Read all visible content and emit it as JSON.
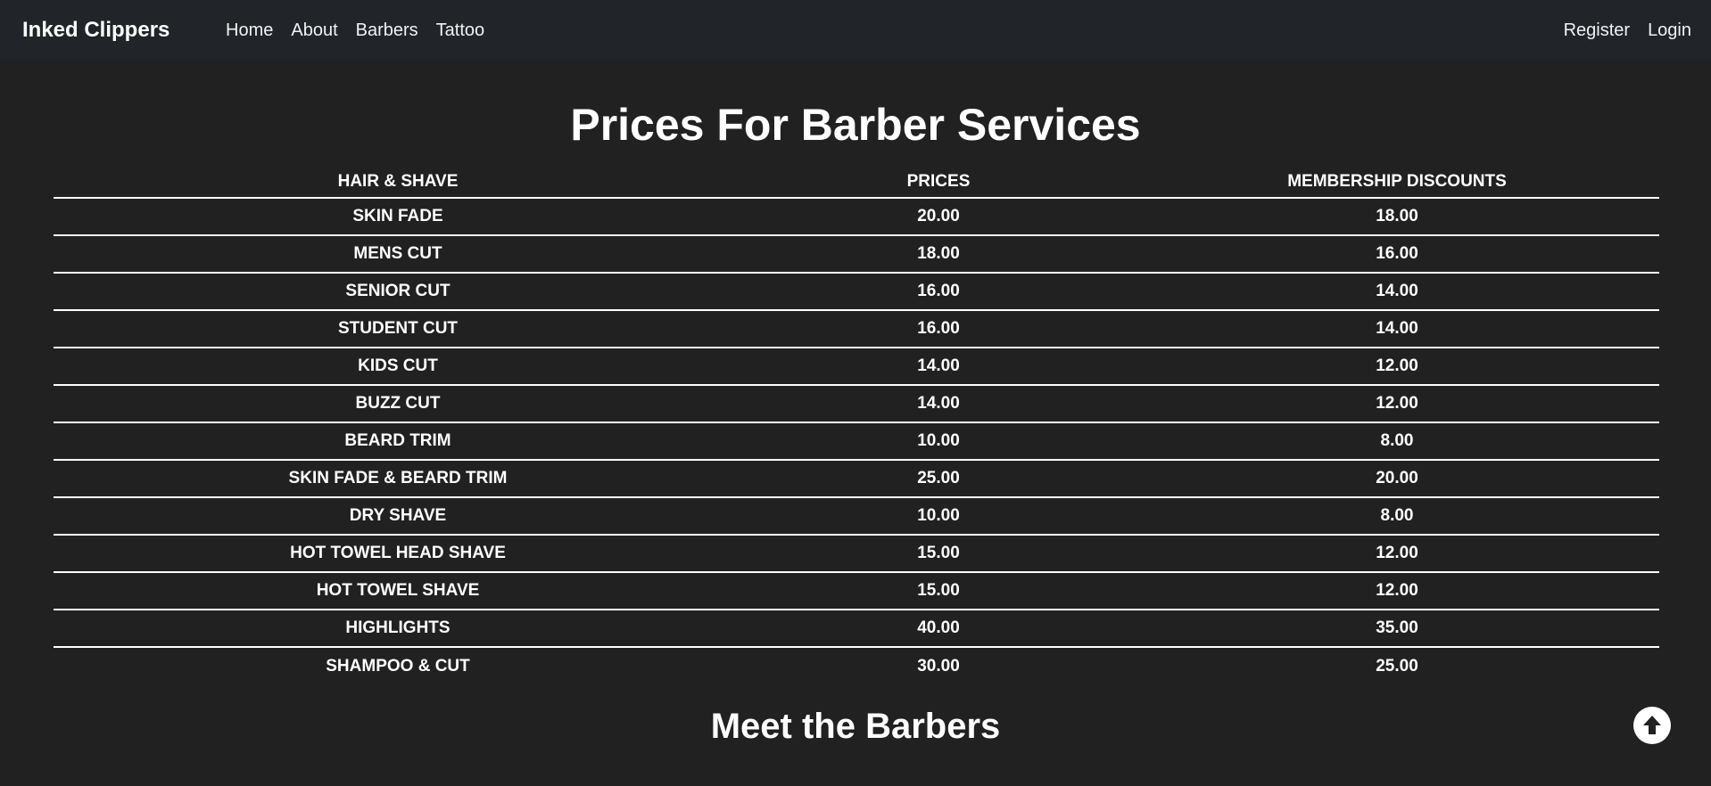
{
  "nav": {
    "brand": "Inked Clippers",
    "links": [
      "Home",
      "About",
      "Barbers",
      "Tattoo"
    ],
    "right_links": [
      "Register",
      "Login"
    ]
  },
  "page": {
    "title": "Prices For Barber Services",
    "section_title": "Meet the Barbers"
  },
  "table": {
    "headers": [
      "HAIR & SHAVE",
      "PRICES",
      "MEMBERSHIP DISCOUNTS"
    ],
    "rows": [
      [
        "SKIN FADE",
        "20.00",
        "18.00"
      ],
      [
        "MENS CUT",
        "18.00",
        "16.00"
      ],
      [
        "SENIOR CUT",
        "16.00",
        "14.00"
      ],
      [
        "STUDENT CUT",
        "16.00",
        "14.00"
      ],
      [
        "KIDS CUT",
        "14.00",
        "12.00"
      ],
      [
        "BUZZ CUT",
        "14.00",
        "12.00"
      ],
      [
        "BEARD TRIM",
        "10.00",
        "8.00"
      ],
      [
        "SKIN FADE & BEARD TRIM",
        "25.00",
        "20.00"
      ],
      [
        "DRY SHAVE",
        "10.00",
        "8.00"
      ],
      [
        "HOT TOWEL HEAD SHAVE",
        "15.00",
        "12.00"
      ],
      [
        "HOT TOWEL SHAVE",
        "15.00",
        "12.00"
      ],
      [
        "HIGHLIGHTS",
        "40.00",
        "35.00"
      ],
      [
        "SHAMPOO & CUT",
        "30.00",
        "25.00"
      ]
    ]
  },
  "icons": {
    "scroll_top": "arrow-up-circle-icon"
  },
  "colors": {
    "background": "#212121",
    "navbar": "#212529",
    "text": "#ffffff"
  }
}
